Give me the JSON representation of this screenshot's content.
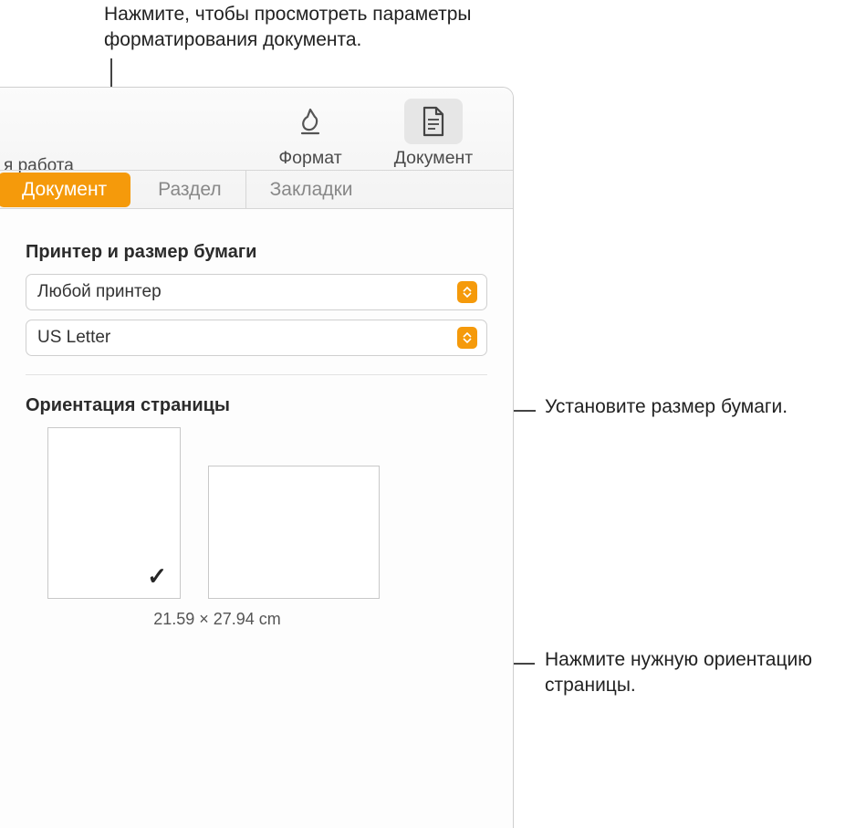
{
  "callouts": {
    "top": "Нажмите, чтобы просмотреть параметры форматирования документа.",
    "paper": "Установите размер бумаги.",
    "orient": "Нажмите нужную ориентацию страницы."
  },
  "toolbar": {
    "partial": "я работа",
    "format": "Формат",
    "document": "Документ"
  },
  "tabs": {
    "document": "Документ",
    "section": "Раздел",
    "bookmarks": "Закладки"
  },
  "printer": {
    "heading": "Принтер и размер бумаги",
    "printer_value": "Любой принтер",
    "paper_value": "US Letter"
  },
  "orientation": {
    "heading": "Ориентация страницы",
    "dimensions": "21.59 × 27.94 cm",
    "check": "✓"
  }
}
